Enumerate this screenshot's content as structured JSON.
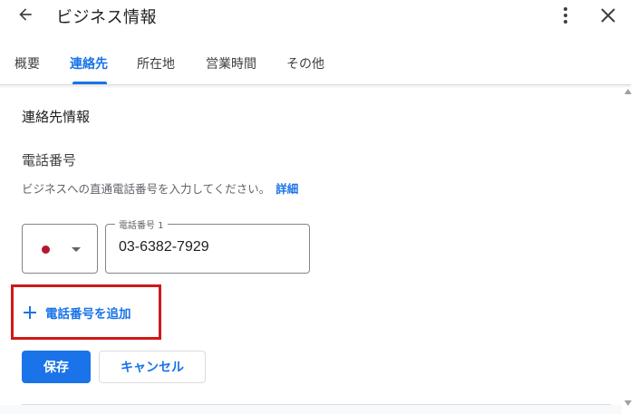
{
  "header": {
    "title": "ビジネス情報",
    "back_icon": "arrow-left-icon",
    "more_icon": "more-vert-icon",
    "close_icon": "close-icon"
  },
  "tabs": [
    {
      "label": "概要",
      "active": false
    },
    {
      "label": "連絡先",
      "active": true
    },
    {
      "label": "所在地",
      "active": false
    },
    {
      "label": "営業時間",
      "active": false
    },
    {
      "label": "その他",
      "active": false
    }
  ],
  "section": {
    "title": "連絡先情報",
    "field_title": "電話番号",
    "field_description": "ビジネスへの直通電話番号を入力してください。",
    "details_link": "詳細"
  },
  "phone": {
    "country_flag": "japan-flag-icon",
    "label": "電話番号 1",
    "value": "03-6382-7929"
  },
  "add_phone_label": "電話番号を追加",
  "buttons": {
    "save": "保存",
    "cancel": "キャンセル"
  },
  "colors": {
    "accent": "#1a73e8",
    "highlight": "#d01818",
    "flag": "#b5162b"
  }
}
